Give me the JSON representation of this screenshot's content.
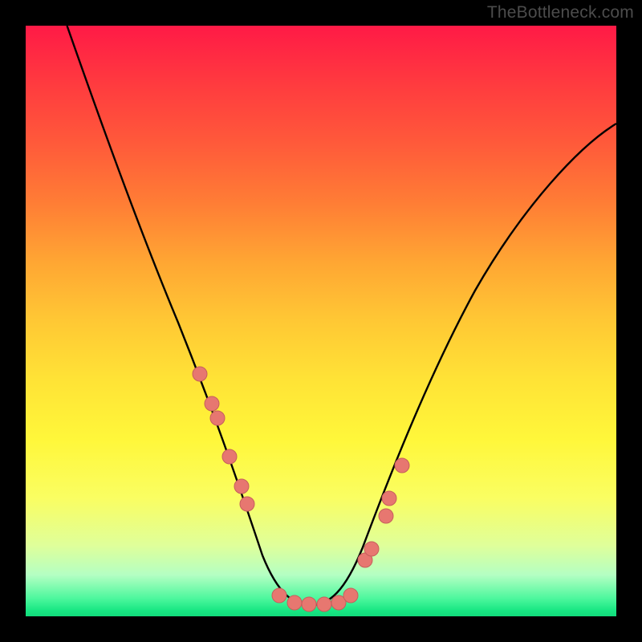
{
  "watermark": "TheBottleneck.com",
  "colors": {
    "frame": "#000000",
    "curve": "#000000",
    "marker_fill": "#e77770",
    "marker_stroke": "#c65f5c"
  },
  "chart_data": {
    "type": "line",
    "title": "",
    "xlabel": "",
    "ylabel": "",
    "xlim": [
      0,
      100
    ],
    "ylim": [
      0,
      100
    ],
    "grid": false,
    "legend": false,
    "annotations": [
      "TheBottleneck.com"
    ],
    "series": [
      {
        "name": "bottleneck-curve",
        "x": [
          7,
          12,
          17,
          22,
          26,
          29,
          32,
          34,
          37,
          39,
          41,
          43,
          45,
          48,
          51,
          55,
          58,
          62,
          67,
          73,
          79,
          86,
          94,
          100
        ],
        "y": [
          100,
          87,
          74,
          62,
          51,
          43,
          35,
          29,
          22,
          16,
          11,
          6,
          3,
          1,
          1,
          3,
          8,
          15,
          24,
          35,
          45,
          55,
          64,
          70
        ]
      }
    ],
    "markers": {
      "name": "highlighted-points",
      "x": [
        29.5,
        31.5,
        32.5,
        34.5,
        36.5,
        37.5,
        43.0,
        45.5,
        48.0,
        50.5,
        53.0,
        55.0,
        57.5,
        58.5,
        61.0,
        61.5,
        63.7
      ],
      "y": [
        41.0,
        36.0,
        33.5,
        27.0,
        22.0,
        19.0,
        3.5,
        2.3,
        2.0,
        2.0,
        2.3,
        3.5,
        9.5,
        11.5,
        17.0,
        20.0,
        25.5
      ]
    }
  }
}
